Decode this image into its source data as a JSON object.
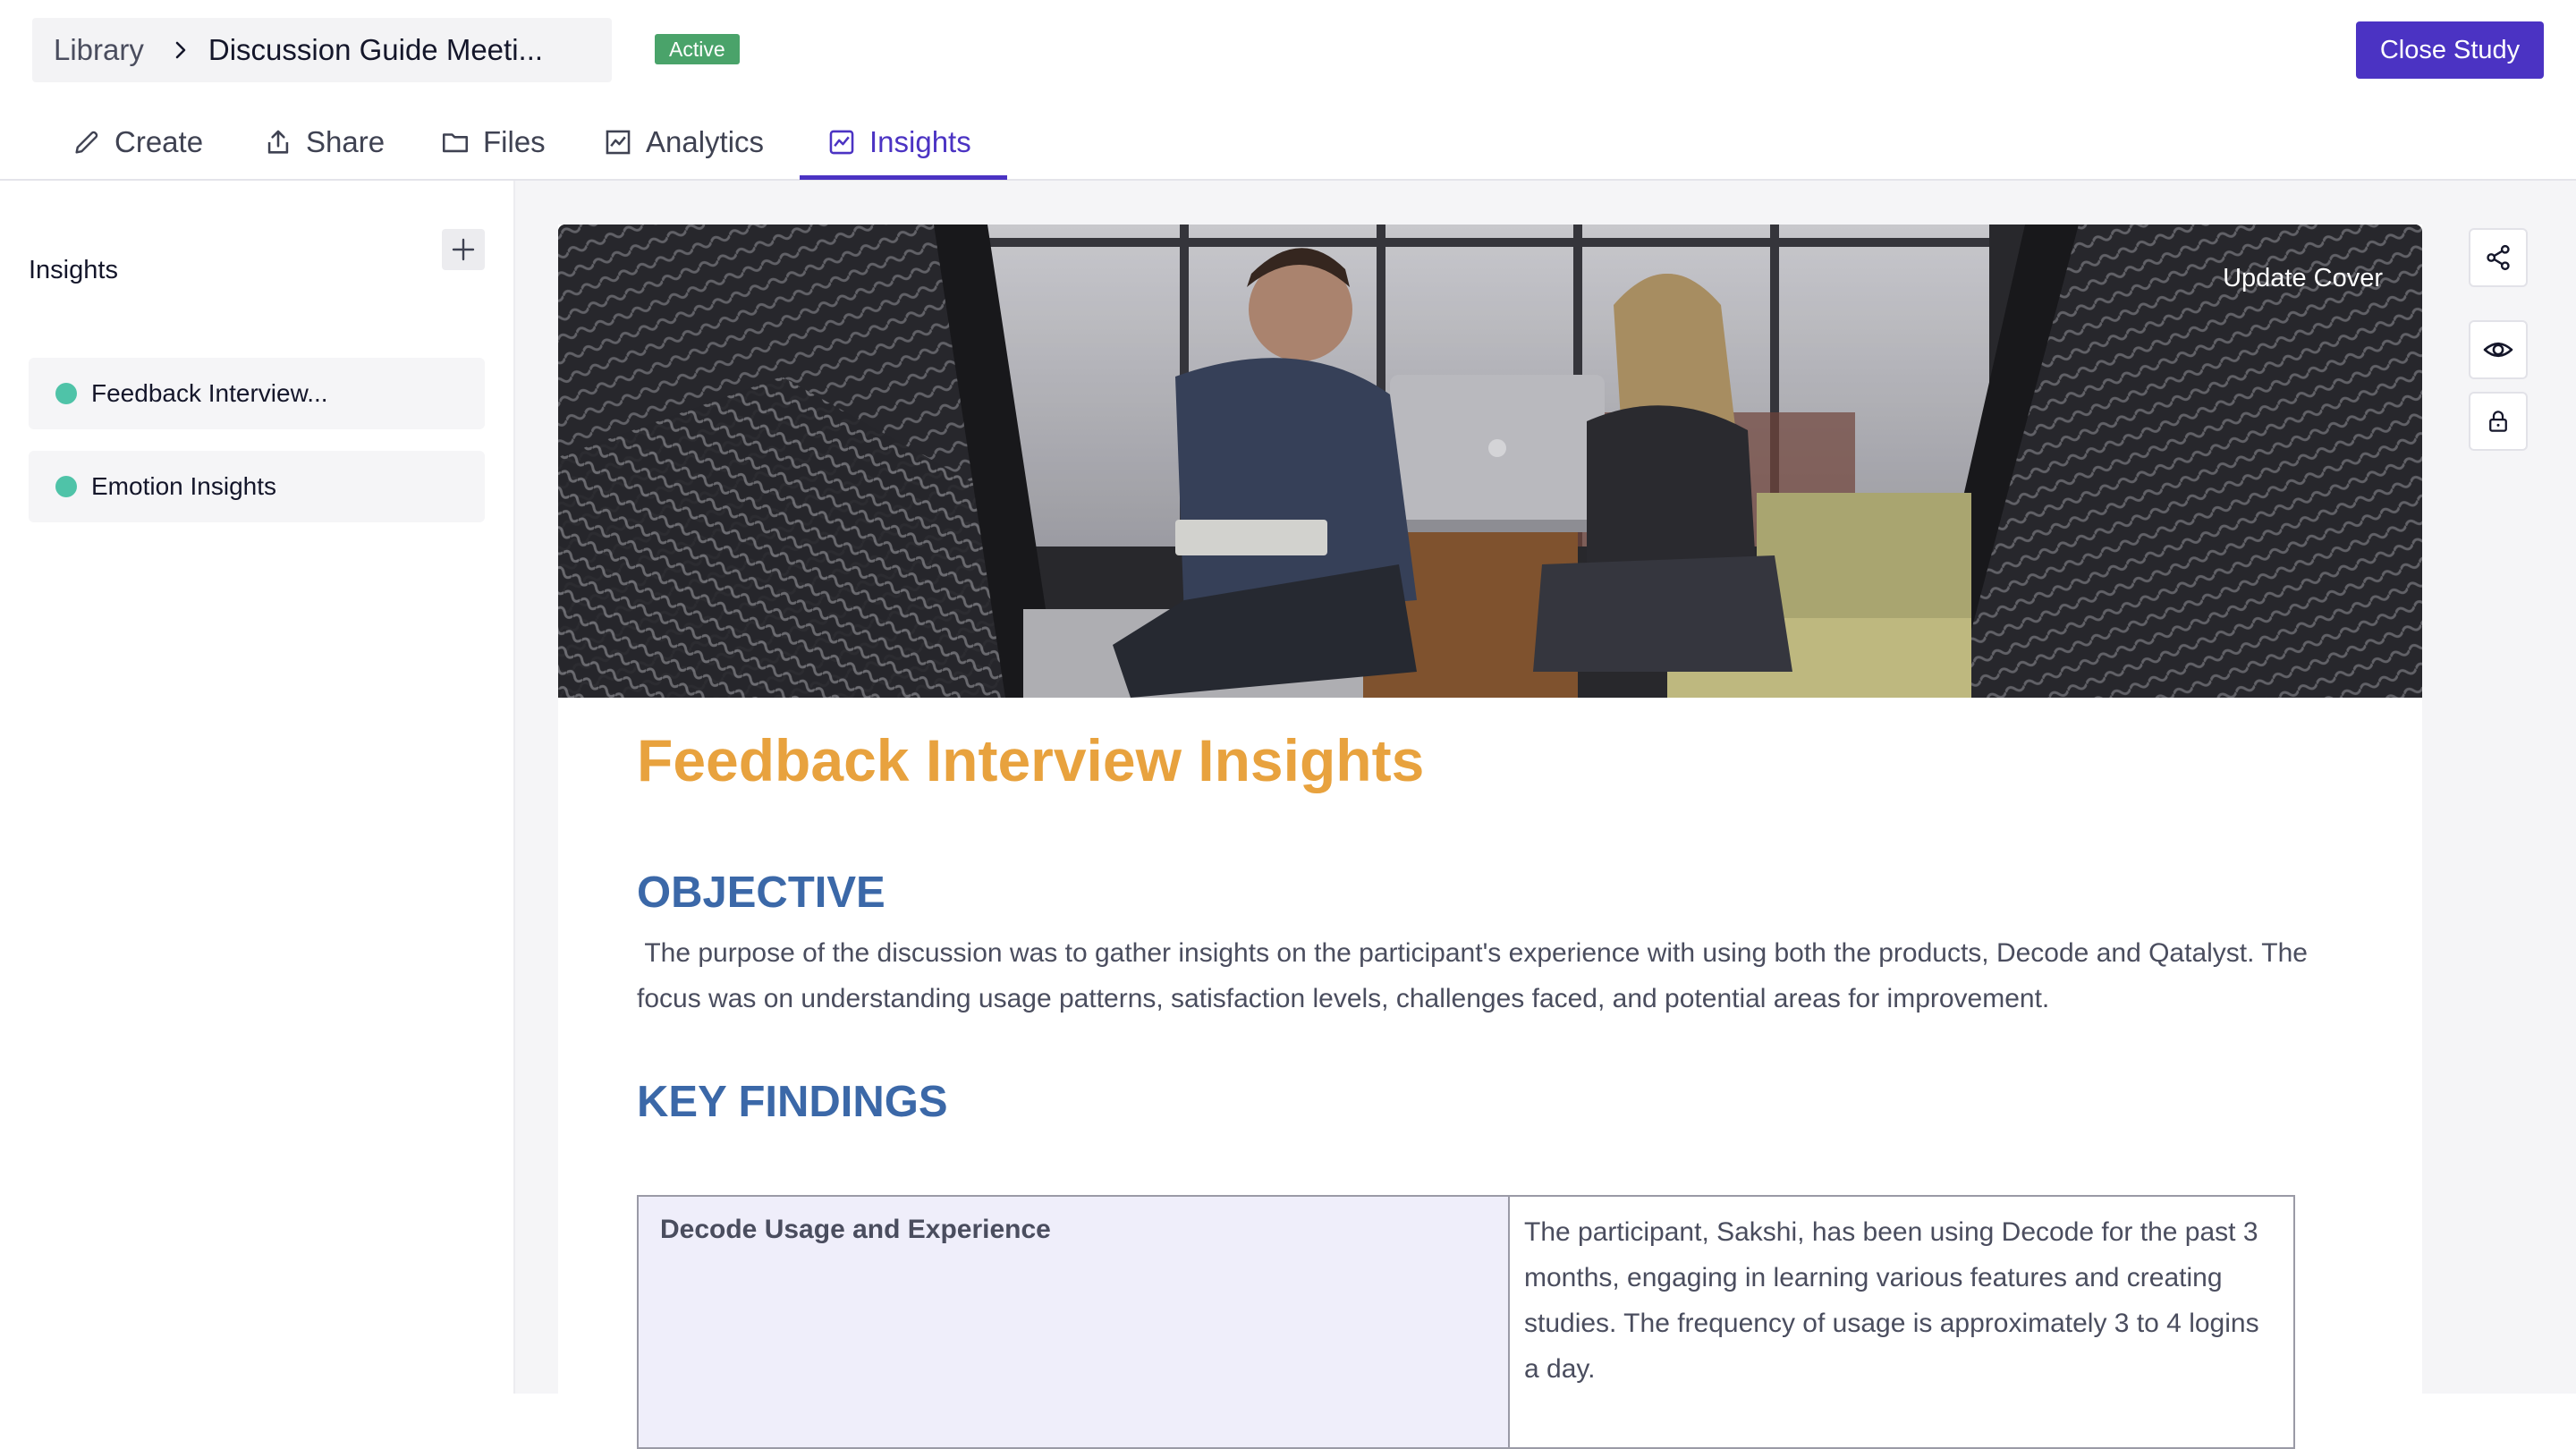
{
  "breadcrumb": {
    "root": "Library",
    "current": "Discussion Guide Meeti..."
  },
  "status": {
    "label": "Active",
    "color": "#4aa36a"
  },
  "header": {
    "close_label": "Close Study",
    "accent": "#4b33c3"
  },
  "tabs": [
    {
      "label": "Create",
      "icon": "pencil-icon"
    },
    {
      "label": "Share",
      "icon": "share-upload-icon"
    },
    {
      "label": "Files",
      "icon": "folder-icon"
    },
    {
      "label": "Analytics",
      "icon": "chart-icon"
    },
    {
      "label": "Insights",
      "icon": "insights-icon",
      "active": true
    }
  ],
  "sidebar": {
    "title": "Insights",
    "add_icon": "plus-icon",
    "items": [
      {
        "label": "Feedback Interview...",
        "dot_color": "#4fc3a8"
      },
      {
        "label": "Emotion Insights",
        "dot_color": "#4fc3a8"
      }
    ]
  },
  "cover": {
    "update_label": "Update Cover"
  },
  "document": {
    "title": "Feedback Interview Insights",
    "objective_heading": "OBJECTIVE",
    "objective_text": " The purpose of the discussion was to gather insights on the participant's experience with using both the products, Decode and Qatalyst. The focus was on understanding usage patterns, satisfaction levels, challenges faced, and potential areas for improvement.",
    "findings_heading": "KEY FINDINGS",
    "findings": [
      {
        "label": "Decode Usage and Experience",
        "value": "The participant, Sakshi, has been using Decode for the past 3 months, engaging in learning various features and creating studies. The frequency of usage is approximately 3 to 4 logins a day."
      }
    ]
  },
  "rail": [
    {
      "icon": "share-nodes-icon"
    },
    {
      "icon": "eye-icon"
    },
    {
      "icon": "lock-icon"
    }
  ]
}
